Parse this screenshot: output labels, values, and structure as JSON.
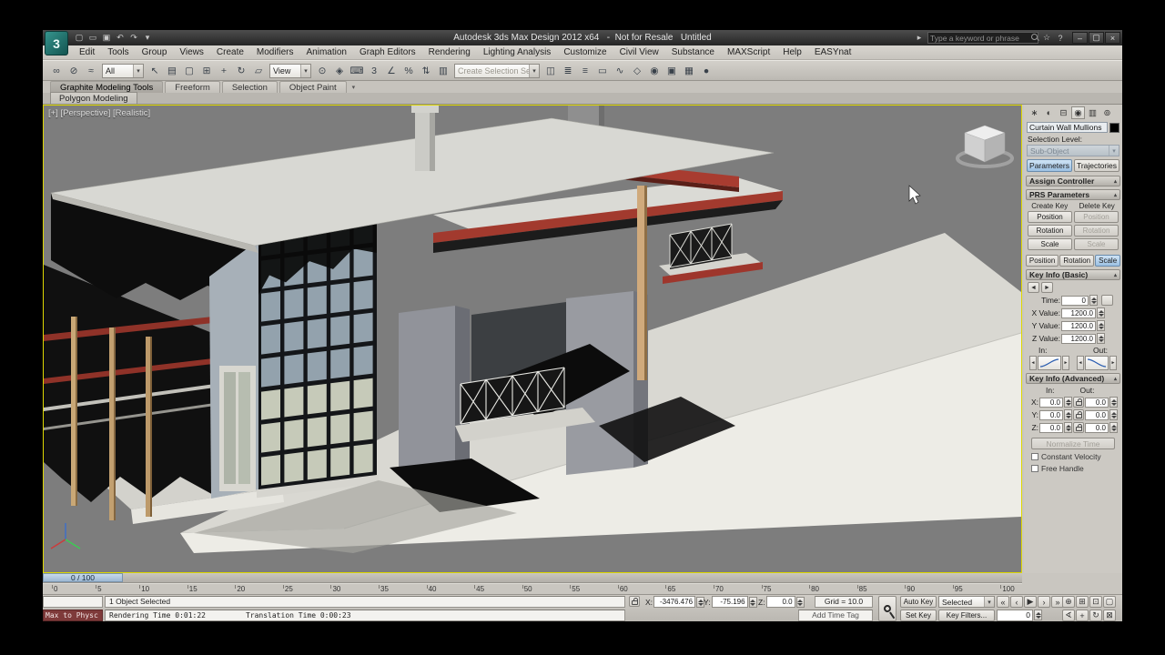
{
  "title_bar": {
    "app_button": "3",
    "title": "Autodesk 3ds Max Design 2012 x64   -  Not for Resale   Untitled",
    "search_placeholder": "Type a keyword or phrase",
    "qat_icons": [
      {
        "g": "▢",
        "n": "new-scene-button"
      },
      {
        "g": "▭",
        "n": "open-file-button"
      },
      {
        "g": "▣",
        "n": "save-file-button"
      },
      {
        "g": "↶",
        "n": "undo-button"
      },
      {
        "g": "↷",
        "n": "redo-button"
      },
      {
        "g": "▾",
        "n": "qat-dropdown-arrow"
      }
    ],
    "info_icons": [
      {
        "g": "☆",
        "n": "favorites-button"
      },
      {
        "g": "?",
        "n": "help-button"
      }
    ],
    "window_buttons": [
      {
        "g": "–",
        "n": "minimize-button"
      },
      {
        "g": "▢",
        "n": "restore-button"
      },
      {
        "g": "×",
        "n": "close-button"
      }
    ]
  },
  "menu_bar": {
    "items": [
      "Edit",
      "Tools",
      "Group",
      "Views",
      "Create",
      "Modifiers",
      "Animation",
      "Graph Editors",
      "Rendering",
      "Lighting Analysis",
      "Customize",
      "Civil View",
      "Substance",
      "MAXScript",
      "Help",
      "EASYnat"
    ]
  },
  "toolbar": {
    "items": [
      {
        "t": "icon",
        "g": "∞",
        "n": "select-and-link-button"
      },
      {
        "t": "icon",
        "g": "⊘",
        "n": "unlink-selection-button"
      },
      {
        "t": "icon",
        "g": "≈",
        "n": "bind-to-space-warp-button"
      },
      {
        "t": "dd",
        "v": "All",
        "n": "selection-filter-dropdown"
      },
      {
        "t": "icon",
        "g": "↖",
        "n": "select-object-button"
      },
      {
        "t": "icon",
        "g": "▤",
        "n": "select-by-name-button"
      },
      {
        "t": "icon",
        "g": "▢",
        "n": "rectangular-selection-region-button"
      },
      {
        "t": "icon",
        "g": "⊞",
        "n": "window-crossing-toggle"
      },
      {
        "t": "icon",
        "g": "+",
        "n": "select-and-move-button"
      },
      {
        "t": "icon",
        "g": "↻",
        "n": "select-and-rotate-button"
      },
      {
        "t": "icon",
        "g": "▱",
        "n": "select-and-scale-button"
      },
      {
        "t": "dd",
        "v": "View",
        "n": "reference-coordinate-dropdown"
      },
      {
        "t": "icon",
        "g": "⊙",
        "n": "use-pivot-point-button"
      },
      {
        "t": "icon",
        "g": "◈",
        "n": "select-and-manipulate-button"
      },
      {
        "t": "icon",
        "g": "⌨",
        "n": "keyboard-shortcut-override-toggle"
      },
      {
        "t": "icon",
        "g": "3",
        "n": "snaps-toggle"
      },
      {
        "t": "icon",
        "g": "∠",
        "n": "angle-snap-toggle"
      },
      {
        "t": "icon",
        "g": "%",
        "n": "percent-snap-toggle"
      },
      {
        "t": "icon",
        "g": "⇅",
        "n": "spinner-snap-toggle"
      },
      {
        "t": "icon",
        "g": "▥",
        "n": "edit-named-selection-sets-button"
      },
      {
        "t": "combo",
        "v": "Create Selection Se",
        "n": "named-selection-sets-combo"
      },
      {
        "t": "icon",
        "g": "◫",
        "n": "mirror-button"
      },
      {
        "t": "icon",
        "g": "≣",
        "n": "align-button"
      },
      {
        "t": "icon",
        "g": "≡",
        "n": "layer-manager-button"
      },
      {
        "t": "icon",
        "g": "▭",
        "n": "ribbon-toggle-button"
      },
      {
        "t": "icon",
        "g": "∿",
        "n": "curve-editor-button"
      },
      {
        "t": "icon",
        "g": "◇",
        "n": "schematic-view-button"
      },
      {
        "t": "icon",
        "g": "◉",
        "n": "material-editor-button"
      },
      {
        "t": "icon",
        "g": "▣",
        "n": "render-setup-button"
      },
      {
        "t": "icon",
        "g": "▦",
        "n": "rendered-frame-window-button"
      },
      {
        "t": "icon",
        "g": "●",
        "n": "render-production-button"
      }
    ]
  },
  "ribbon": {
    "tabs": [
      {
        "label": "Graphite Modeling Tools",
        "active": true
      },
      {
        "label": "Freeform",
        "active": false
      },
      {
        "label": "Selection",
        "active": false
      },
      {
        "label": "Object Paint",
        "active": false
      }
    ],
    "subtab": "Polygon Modeling"
  },
  "viewport": {
    "label": "[+] [Perspective] [Realistic]"
  },
  "command_panel": {
    "tabs": [
      {
        "g": "∗",
        "n": "create-tab",
        "active": false
      },
      {
        "g": "◐",
        "n": "modify-tab",
        "active": false
      },
      {
        "g": "⊟",
        "n": "hierarchy-tab",
        "active": false
      },
      {
        "g": "◉",
        "n": "motion-tab",
        "active": true
      },
      {
        "g": "▥",
        "n": "display-tab",
        "active": false
      },
      {
        "g": "⊚",
        "n": "utilities-tab",
        "active": false
      }
    ],
    "object_name": "Curtain Wall Mullions",
    "selection_level": "Selection Level:",
    "sub_object": "Sub-Object",
    "mode_buttons": [
      "Parameters",
      "Trajectories"
    ],
    "rollout_assign": "Assign Controller",
    "prs": {
      "title": "PRS Parameters",
      "create_key": "Create Key",
      "delete_key": "Delete Key",
      "rows": [
        "Position",
        "Rotation",
        "Scale"
      ],
      "toggle_row": [
        "Position",
        "Rotation",
        "Scale"
      ],
      "toggle_active": "Scale"
    },
    "key_basic": {
      "title": "Key Info (Basic)",
      "time_label": "Time:",
      "time_value": "0",
      "fields": [
        {
          "label": "X Value:",
          "value": "1200.0"
        },
        {
          "label": "Y Value:",
          "value": "1200.0"
        },
        {
          "label": "Z Value:",
          "value": "1200.0"
        }
      ],
      "in_label": "In:",
      "out_label": "Out:"
    },
    "key_adv": {
      "title": "Key Info (Advanced)",
      "in_label": "In:",
      "out_label": "Out:",
      "rows": [
        {
          "axis": "X:",
          "in": "0.0",
          "out": "0.0"
        },
        {
          "axis": "Y:",
          "in": "0.0",
          "out": "0.0"
        },
        {
          "axis": "Z:",
          "in": "0.0",
          "out": "0.0"
        }
      ],
      "normalize": "Normalize Time",
      "constant_velocity": "Constant Velocity",
      "free_handle": "Free Handle"
    }
  },
  "timeline": {
    "slider_label": "0 / 100",
    "ticks": [
      "0",
      "5",
      "10",
      "15",
      "20",
      "25",
      "30",
      "35",
      "40",
      "45",
      "50",
      "55",
      "60",
      "65",
      "70",
      "75",
      "80",
      "85",
      "90",
      "95",
      "100"
    ]
  },
  "status_bar": {
    "prompt": "1 Object Selected",
    "x_label": "X:",
    "x_value": "-3476.476",
    "y_label": "Y:",
    "y_value": "-75.196",
    "z_label": "Z:",
    "z_value": "0.0",
    "grid": "Grid = 10.0",
    "add_time_tag": "Add Time Tag",
    "auto_key": "Auto Key",
    "set_key": "Set Key",
    "selected_dropdown": "Selected",
    "key_filters": "Key Filters...",
    "frame_value": "0",
    "listener_left": "Max to Physc",
    "render_time": "Rendering Time  0:01:22",
    "translation_time": "Translation Time  0:00:23",
    "playback": [
      {
        "g": "«",
        "n": "go-to-start-button"
      },
      {
        "g": "‹",
        "n": "previous-frame-button"
      },
      {
        "g": "▶",
        "n": "play-animation-button"
      },
      {
        "g": "›",
        "n": "next-frame-button"
      },
      {
        "g": "»",
        "n": "go-to-end-button"
      }
    ],
    "nav_row1": [
      {
        "g": "⊕",
        "n": "zoom-button"
      },
      {
        "g": "⊞",
        "n": "zoom-all-button"
      },
      {
        "g": "⊡",
        "n": "zoom-extents-button"
      },
      {
        "g": "▢",
        "n": "zoom-region-button"
      }
    ],
    "nav_row2": [
      {
        "g": "∢",
        "n": "field-of-view-button"
      },
      {
        "g": "+",
        "n": "pan-view-button"
      },
      {
        "g": "↻",
        "n": "orbit-view-button"
      },
      {
        "g": "⊠",
        "n": "maximize-viewport-toggle"
      }
    ]
  }
}
